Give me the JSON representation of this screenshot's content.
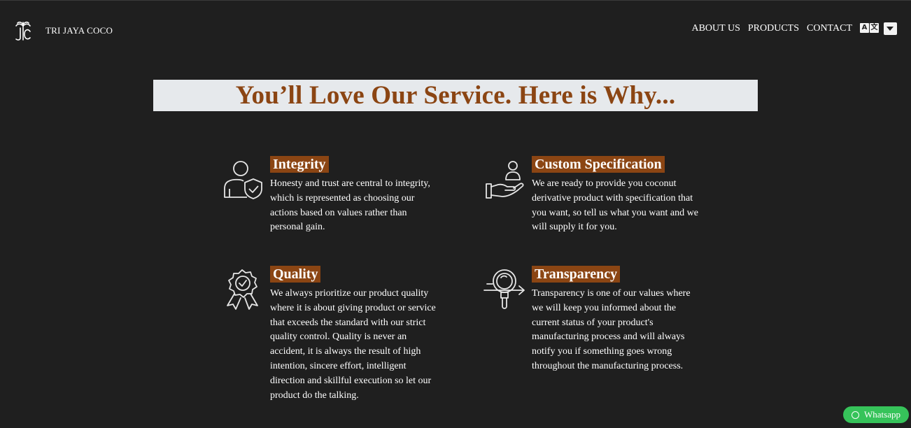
{
  "brand": {
    "name": "TRI JAYA COCO",
    "logo_icon": "palm-logo-icon"
  },
  "nav": {
    "items": [
      {
        "label": "ABOUT US"
      },
      {
        "label": "PRODUCTS"
      },
      {
        "label": "CONTACT"
      }
    ],
    "translate_icon": "translate-icon",
    "dropdown_icon": "chevron-down-icon"
  },
  "hero": {
    "title": "You’ll Love Our Service. Here is Why..."
  },
  "features": [
    {
      "icon": "person-shield-icon",
      "title": "Integrity",
      "description": "Honesty and trust are central to integrity, which is represented as choosing our actions based on values rather than personal gain."
    },
    {
      "icon": "hand-person-icon",
      "title": "Custom Specification",
      "description": "We are ready to provide you coconut derivative product with specification that you want, so tell us what you want and we will supply it for you."
    },
    {
      "icon": "award-ribbon-icon",
      "title": "Quality",
      "description": "We always prioritize our product quality where it is about giving product or service that exceeds the standard with our strict quality control. Quality is never an accident, it is always the result of high intention, sincere effort, intelligent direction and skillful execution so let our product do the talking."
    },
    {
      "icon": "magnifier-arrow-icon",
      "title": "Transparency",
      "description": "Transparency is one of our values where we will keep you informed about the current status of your product's manufacturing process and will always notify you if something goes wrong throughout the manufacturing process."
    }
  ],
  "whatsapp": {
    "label": "Whatsapp",
    "icon": "whatsapp-icon"
  },
  "colors": {
    "background": "#1f1f1f",
    "accent": "#8b4513",
    "title_bar": "#e6e9ec",
    "whatsapp": "#36c35a"
  }
}
